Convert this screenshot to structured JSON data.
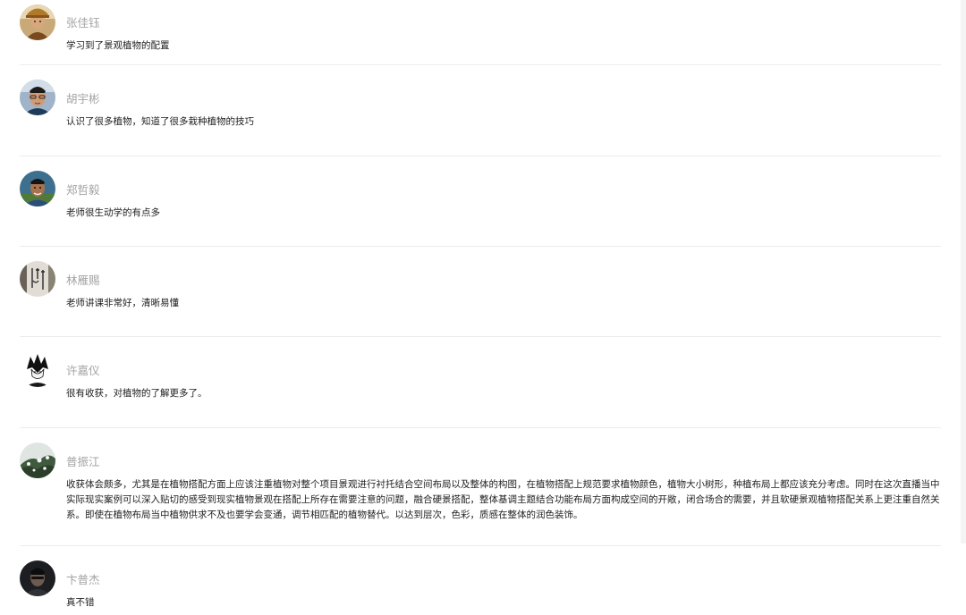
{
  "comments": [
    {
      "author": "张佳钰",
      "avatar_icon": "avatar-man-hat-icon",
      "text": "学习到了景观植物的配置"
    },
    {
      "author": "胡宇彬",
      "avatar_icon": "avatar-man-glasses-icon",
      "text": "认识了很多植物，知道了很多栽种植物的技巧"
    },
    {
      "author": "郑哲毅",
      "avatar_icon": "avatar-man-outdoor-icon",
      "text": "老师很生动学的有点多"
    },
    {
      "author": "林雁赐",
      "avatar_icon": "avatar-calligraphy-icon",
      "text": "老师讲课非常好，清晰易懂"
    },
    {
      "author": "许嘉仪",
      "avatar_icon": "avatar-anime-sketch-icon",
      "text": "很有收获，对植物的了解更多了。"
    },
    {
      "author": "普振江",
      "avatar_icon": "avatar-snow-tree-icon",
      "text": "收获体会颇多，尤其是在植物搭配方面上应该注重植物对整个项目景观进行衬托结合空间布局以及整体的构图，在植物搭配上规范要求植物颜色，植物大小树形，种植布局上都应该充分考虑。同时在这次直播当中实际现实案例可以深入贴切的感受到现实植物景观在搭配上所存在需要注意的问题，融合硬景搭配，整体基调主题结合功能布局方面构成空间的开敞，闭合场合的需要，并且软硬景观植物搭配关系上更注重自然关系。即使在植物布局当中植物供求不及也要学会变通，调节相匹配的植物替代。以达到层次，色彩，质感在整体的润色装饰。"
    },
    {
      "author": "卞普杰",
      "avatar_icon": "avatar-dark-portrait-icon",
      "text": "真不错"
    }
  ],
  "colors": {
    "author_name": "#a3a3a3",
    "comment_text": "#1f1f1f",
    "divider": "#ececec"
  }
}
